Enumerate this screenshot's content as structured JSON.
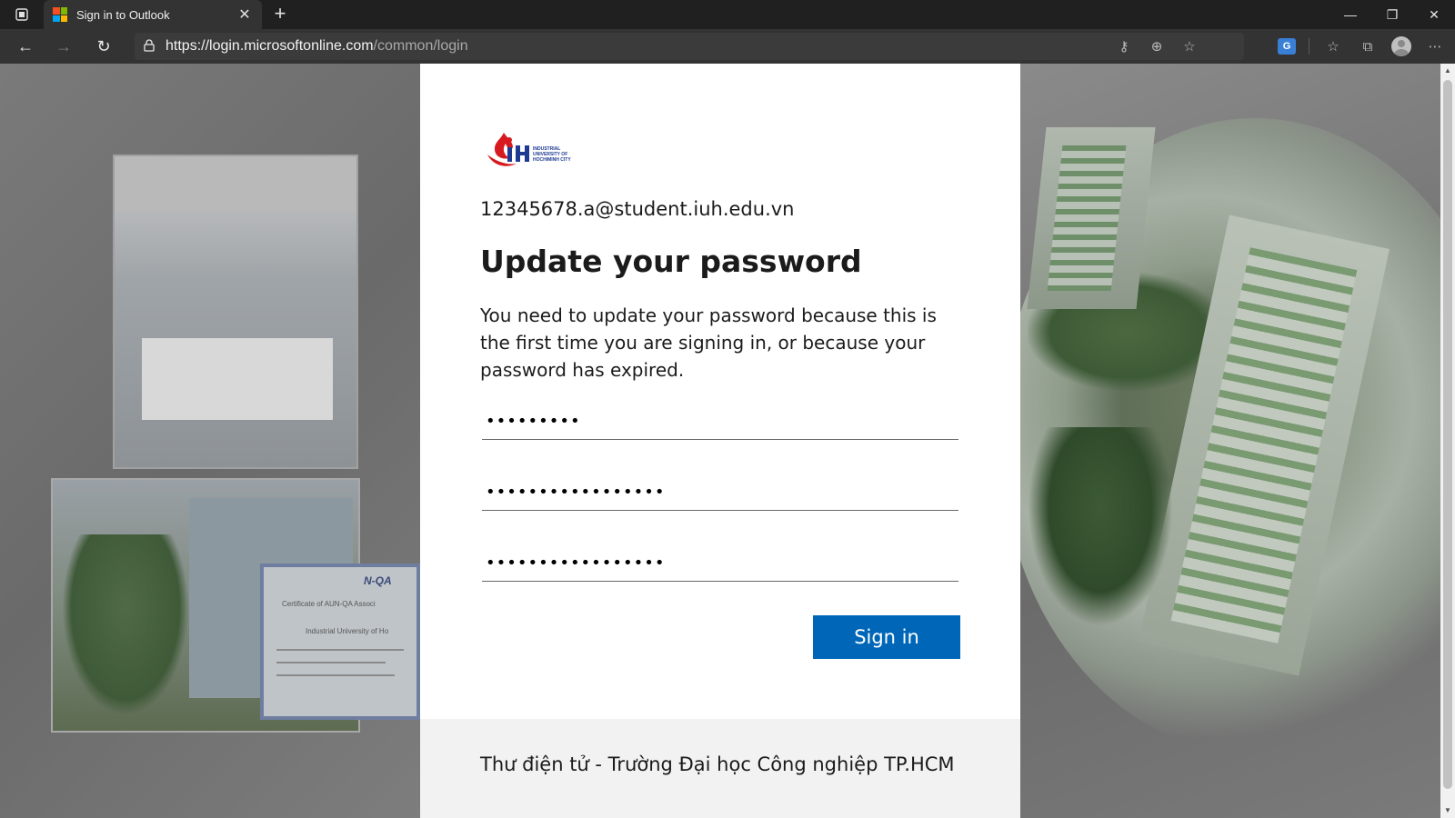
{
  "browser": {
    "tab": {
      "title": "Sign in to Outlook",
      "close_glyph": "✕",
      "favicon_colors": [
        "#f25022",
        "#7fba00",
        "#00a4ef",
        "#ffb900"
      ]
    },
    "new_tab_glyph": "+",
    "window_controls": {
      "minimize": "—",
      "restore": "❐",
      "close": "✕"
    },
    "nav": {
      "back_glyph": "←",
      "forward_glyph": "→",
      "reload_glyph": "↻"
    },
    "address": {
      "lock_glyph": "🔒",
      "host": "https://login.microsoftonline.com",
      "path": "/common/login"
    },
    "address_icons": {
      "key": "⚷",
      "zoom": "⊕",
      "favorite_add": "☆",
      "translate": "G"
    },
    "toolbar": {
      "favorites": "☆",
      "collections": "⧉",
      "menu": "⋯"
    }
  },
  "scrollbar": {
    "up": "▲",
    "down": "▼"
  },
  "background": {
    "certificate_title": "N-QA",
    "certificate_line1": "Certificate of AUN-QA Associ",
    "certificate_line2": "Industrial University of Ho"
  },
  "signin": {
    "identity": "12345678.a@student.iuh.edu.vn",
    "heading": "Update your password",
    "description": "You need to update your password because this is the first time you are signing in, or because your password has expired.",
    "current_password": "•••••••••",
    "new_password": "•••••••••••••••••",
    "confirm_password": "•••••••••••••••••",
    "submit_label": "Sign in",
    "footer": "Thư điện tử - Trường Đại học Công nghiệp TP.HCM",
    "logo_text_lines": [
      "INDUSTRIAL",
      "UNIVERSITY OF",
      "HOCHIMINH CITY"
    ],
    "colors": {
      "primary_button": "#0067b8",
      "logo_red": "#d71920",
      "logo_blue": "#1f3a93"
    }
  }
}
